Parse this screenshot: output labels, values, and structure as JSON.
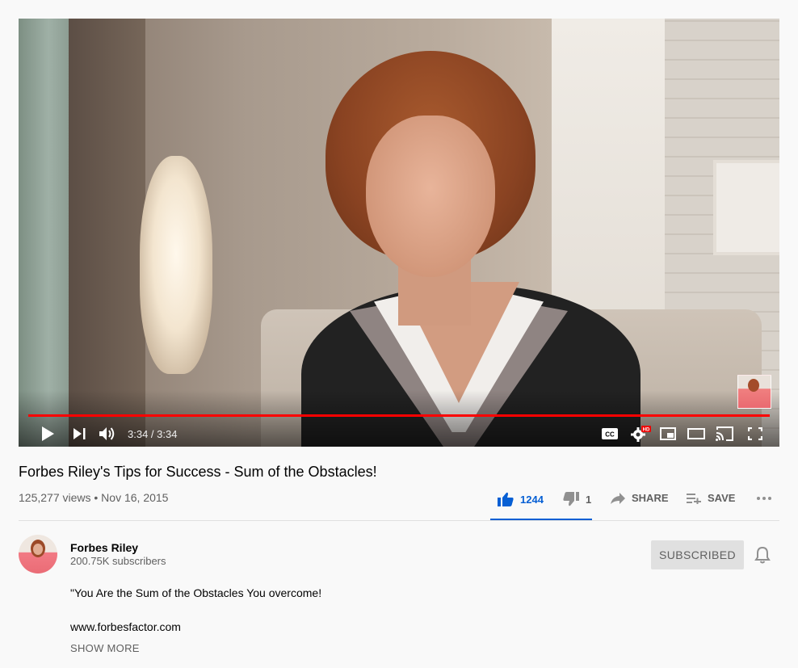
{
  "player": {
    "time": "3:34 / 3:34",
    "progress_fraction": 1.0,
    "accent_color": "#ff0000",
    "controls": {
      "play_icon": "play-icon",
      "next_icon": "next-icon",
      "volume_icon": "volume-icon",
      "captions_icon": "captions-icon",
      "settings_icon": "settings-icon",
      "settings_badge": "HD",
      "miniplayer_icon": "miniplayer-icon",
      "theater_icon": "theater-icon",
      "cast_icon": "cast-icon",
      "fullscreen_icon": "fullscreen-icon"
    }
  },
  "video": {
    "title": "Forbes Riley's Tips for Success - Sum of the Obstacles!",
    "meta": "125,277 views • Nov 16, 2015"
  },
  "actions": {
    "likes": "1244",
    "dislikes": "1",
    "share_label": "SHARE",
    "save_label": "SAVE",
    "like_color": "#065fd4"
  },
  "channel": {
    "name": "Forbes Riley",
    "subscribers": "200.75K subscribers",
    "subscribe_label": "SUBSCRIBED"
  },
  "description": {
    "line1": "\"You Are the Sum of the Obstacles You overcome!",
    "line2": "www.forbesfactor.com",
    "show_more": "SHOW MORE"
  }
}
